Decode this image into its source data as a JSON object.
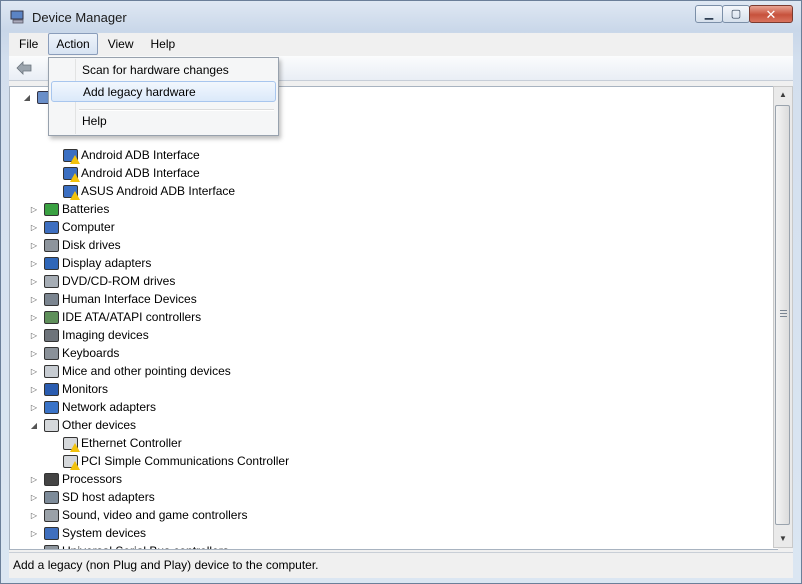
{
  "window": {
    "title": "Device Manager"
  },
  "menubar": {
    "items": [
      {
        "label": "File"
      },
      {
        "label": "Action",
        "active": true
      },
      {
        "label": "View"
      },
      {
        "label": "Help"
      }
    ]
  },
  "action_menu": {
    "items": [
      {
        "label": "Scan for hardware changes"
      },
      {
        "label": "Add legacy hardware",
        "highlighted": true
      },
      {
        "label": "Help"
      }
    ]
  },
  "tree": {
    "rows": [
      {
        "label": "Android ADB Interface",
        "level": 2,
        "icon": "android-device-warning-icon",
        "warn": true
      },
      {
        "label": "Android ADB Interface",
        "level": 2,
        "icon": "android-device-warning-icon",
        "warn": true
      },
      {
        "label": "ASUS Android ADB Interface",
        "level": 2,
        "icon": "android-device-warning-icon",
        "warn": true
      },
      {
        "label": "Batteries",
        "level": 1,
        "icon": "battery-icon",
        "expander": "right"
      },
      {
        "label": "Computer",
        "level": 1,
        "icon": "computer-icon",
        "expander": "right"
      },
      {
        "label": "Disk drives",
        "level": 1,
        "icon": "disk-drive-icon",
        "expander": "right"
      },
      {
        "label": "Display adapters",
        "level": 1,
        "icon": "display-adapter-icon",
        "expander": "right"
      },
      {
        "label": "DVD/CD-ROM drives",
        "level": 1,
        "icon": "dvd-drive-icon",
        "expander": "right"
      },
      {
        "label": "Human Interface Devices",
        "level": 1,
        "icon": "hid-icon",
        "expander": "right"
      },
      {
        "label": "IDE ATA/ATAPI controllers",
        "level": 1,
        "icon": "ide-controller-icon",
        "expander": "right"
      },
      {
        "label": "Imaging devices",
        "level": 1,
        "icon": "camera-icon",
        "expander": "right"
      },
      {
        "label": "Keyboards",
        "level": 1,
        "icon": "keyboard-icon",
        "expander": "right"
      },
      {
        "label": "Mice and other pointing devices",
        "level": 1,
        "icon": "mouse-icon",
        "expander": "right"
      },
      {
        "label": "Monitors",
        "level": 1,
        "icon": "monitor-icon",
        "expander": "right"
      },
      {
        "label": "Network adapters",
        "level": 1,
        "icon": "network-adapter-icon",
        "expander": "right"
      },
      {
        "label": "Other devices",
        "level": 1,
        "icon": "unknown-device-icon",
        "expander": "down"
      },
      {
        "label": "Ethernet Controller",
        "level": 2,
        "icon": "unknown-device-warning-icon",
        "warn": true
      },
      {
        "label": "PCI Simple Communications Controller",
        "level": 2,
        "icon": "unknown-device-warning-icon",
        "warn": true
      },
      {
        "label": "Processors",
        "level": 1,
        "icon": "processor-icon",
        "expander": "right"
      },
      {
        "label": "SD host adapters",
        "level": 1,
        "icon": "sd-adapter-icon",
        "expander": "right"
      },
      {
        "label": "Sound, video and game controllers",
        "level": 1,
        "icon": "speaker-icon",
        "expander": "right"
      },
      {
        "label": "System devices",
        "level": 1,
        "icon": "system-device-icon",
        "expander": "right"
      },
      {
        "label": "Universal Serial Bus controllers",
        "level": 1,
        "icon": "usb-icon",
        "expander": "right"
      }
    ]
  },
  "statusbar": {
    "text": "Add a legacy (non Plug and Play) device to the computer."
  },
  "colors": {
    "menu_highlight": "#dbe9fa",
    "warning": "#f2c20b",
    "icon_blue": "#2c62b4"
  }
}
